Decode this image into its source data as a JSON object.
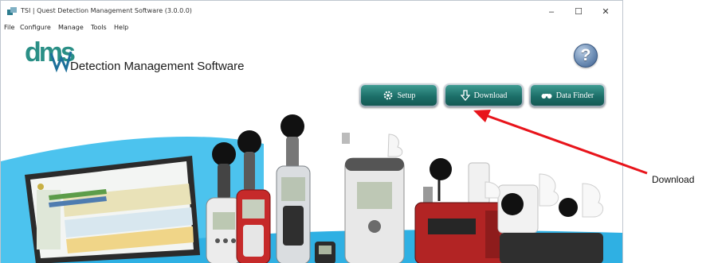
{
  "window": {
    "title": "TSI | Quest Detection Management Software (3.0.0.0)",
    "controls": {
      "minimize": "–",
      "maximize": "☐",
      "close": "✕"
    }
  },
  "menu": [
    "File",
    "Configure",
    "Manage",
    "Tools",
    "Help"
  ],
  "logo": {
    "mark": "dms",
    "subtitle": "Detection Management Software"
  },
  "help": {
    "label": "?"
  },
  "nav": {
    "setup": {
      "label": "Setup",
      "icon": "gear-icon"
    },
    "download": {
      "label": "Download",
      "icon": "download-arrow-icon"
    },
    "data_finder": {
      "label": "Data Finder",
      "icon": "binoculars-icon"
    }
  },
  "callout": {
    "label": "Download"
  },
  "colors": {
    "button_teal": "#1c6f69",
    "arrow_red": "#e8141b",
    "accent_blue": "#35b6e6"
  }
}
